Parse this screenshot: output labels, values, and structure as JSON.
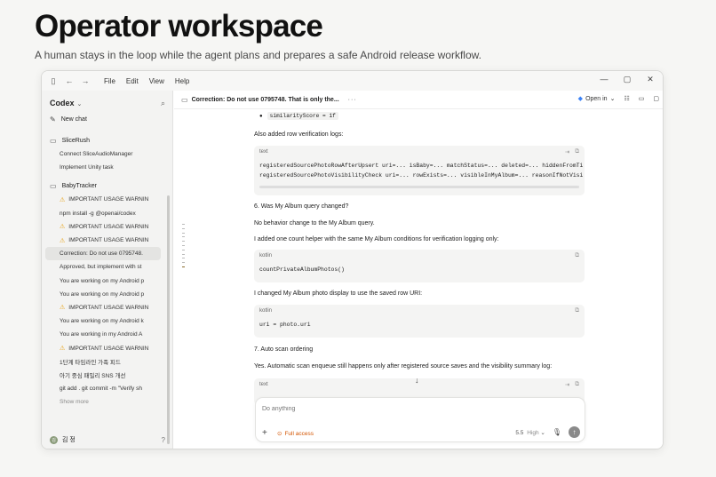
{
  "hero": {
    "title": "Operator workspace",
    "subtitle": "A human stays in the loop while the agent plans and prepares a safe Android release workflow."
  },
  "titlebar": {
    "menu": [
      "File",
      "Edit",
      "View",
      "Help"
    ]
  },
  "sidebar": {
    "brand": "Codex",
    "new_chat": "New chat",
    "projects": [
      {
        "name": "SliceRush",
        "threads": [
          "Connect SliceAudioManager",
          "Implement Unity task"
        ]
      }
    ],
    "baby_tracker": {
      "name": "BabyTracker",
      "threads": [
        {
          "label": "IMPORTANT USAGE WARNIN",
          "warn": true
        },
        {
          "label": "npm install -g @openai/codex",
          "warn": false
        },
        {
          "label": "IMPORTANT USAGE WARNIN",
          "warn": true
        },
        {
          "label": "IMPORTANT USAGE WARNIN",
          "warn": true
        },
        {
          "label": "Correction: Do not use 0795748.",
          "warn": false,
          "active": true
        },
        {
          "label": "Approved, but implement with st",
          "warn": false
        },
        {
          "label": "You are working on my Android p",
          "warn": false
        },
        {
          "label": "You are working on my Android p",
          "warn": false
        },
        {
          "label": "IMPORTANT USAGE WARNIN",
          "warn": true
        },
        {
          "label": "You are working on my Android k",
          "warn": false
        },
        {
          "label": "You are working in my Android A",
          "warn": false
        },
        {
          "label": "IMPORTANT USAGE WARNIN",
          "warn": true
        },
        {
          "label": "1단계 타임라인 가족 피드",
          "warn": false
        },
        {
          "label": "아기 중심 패밀리 SNS 개선",
          "warn": false
        },
        {
          "label": "git add . git commit -m \"Verify sh",
          "warn": false
        }
      ],
      "show_more": "Show more"
    },
    "user": {
      "initial": "김",
      "name": "김 정"
    }
  },
  "main": {
    "title": "Correction: Do not use 0795748. That is only the...",
    "open_in": "Open in",
    "bullet_code": "similarityScore = 1f",
    "p1": "Also added row verification logs:",
    "cb1": {
      "lang": "text",
      "lines": [
        "registeredSourcePhotoRowAfterUpsert uri=... isBaby=... matchStatus=... deleted=... hiddenFromTi",
        "registeredSourcePhotoVisibilityCheck uri=... rowExists=... visibleInMyAlbum=... reasonIfNotVisi"
      ]
    },
    "h6": "6. Was My Album query changed?",
    "p2": "No behavior change to the My Album query.",
    "p3": "I added one count helper with the same My Album conditions for verification logging only:",
    "cb2": {
      "lang": "kotlin",
      "code": "countPrivateAlbumPhotos()"
    },
    "p4": "I changed My Album photo display to use the saved row URI:",
    "cb3": {
      "lang": "kotlin",
      "code": "uri = photo.uri"
    },
    "h7": "7. Auto scan ordering",
    "p5": "Yes. Automatic scan enqueue still happens only after registered source saves and the visibility summary log:",
    "cb4": {
      "lang": "text"
    }
  },
  "composer": {
    "placeholder": "Do anything",
    "access": "Full access",
    "model": "5.5",
    "effort": "High"
  }
}
